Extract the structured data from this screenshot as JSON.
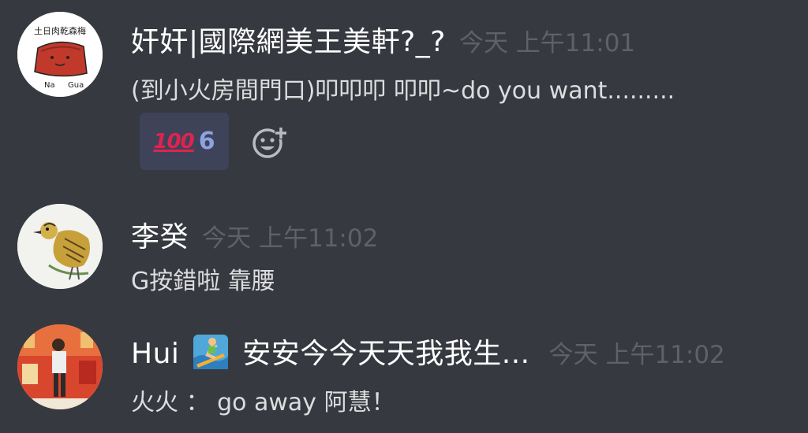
{
  "messages": [
    {
      "username": "奸奸|國際網美王美軒?_?",
      "timestamp": "今天 上午11:01",
      "content": "(到小火房間門口)叩叩叩 叩叩~do you want.........",
      "avatar_text_top": "土日肉乾森梅",
      "avatar_text_left": "Na",
      "avatar_text_right": "Gua",
      "reaction": {
        "emoji": "💯",
        "emoji_glyph": "100",
        "count": "6"
      },
      "add_reaction_icon": "add-reaction-icon"
    },
    {
      "username": "李癸",
      "timestamp": "今天 上午11:02",
      "content": "G按錯啦  靠腰"
    },
    {
      "username_prefix": "Hui",
      "username_emoji": "surfer",
      "username_suffix": "安安今今天天我我生...",
      "timestamp": "今天 上午11:02",
      "content": "火火 ： go away 阿慧！"
    }
  ],
  "colors": {
    "background": "#36393f",
    "username": "#ffffff",
    "timestamp": "#5f6167",
    "content": "#dcddde",
    "reaction_bg": "#3e4359",
    "reaction_count": "#8ea1e1",
    "hundred_red": "#e0234e"
  }
}
